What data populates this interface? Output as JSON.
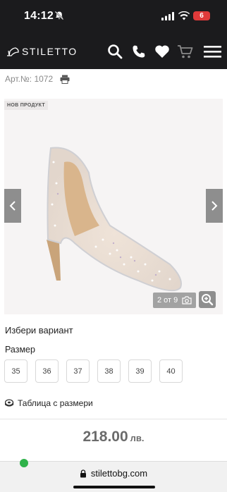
{
  "status_bar": {
    "time": "14:12",
    "battery": "6",
    "icons": [
      "bell-off-icon",
      "signal-icon",
      "wifi-icon",
      "battery-icon"
    ]
  },
  "header": {
    "logo_text": "STILETTO",
    "icons": [
      "search-icon",
      "phone-icon",
      "heart-icon",
      "cart-icon",
      "menu-icon"
    ]
  },
  "product": {
    "article": "Арт.№: 1072",
    "badge": "НОВ ПРОДУКТ",
    "gallery_counter": "2 от 9",
    "variant_title": "Избери вариант",
    "size_label": "Размер",
    "sizes": [
      "35",
      "36",
      "37",
      "38",
      "39",
      "40"
    ],
    "size_table_link": "Таблица с размери",
    "price_amount": "218.00",
    "price_currency": "лв."
  },
  "browser": {
    "url": "stilettobg.com"
  },
  "colors": {
    "header_bg": "#1b1b1d",
    "battery": "#e03a3a",
    "nav_arrow": "#8e8e8e",
    "price": "#6b6b6b"
  }
}
